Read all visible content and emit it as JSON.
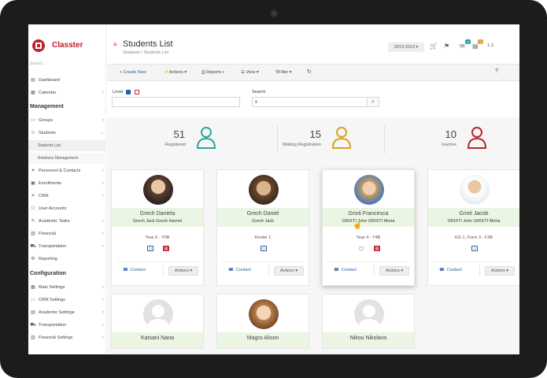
{
  "app": {
    "name": "Classter",
    "search_placeholder": "Search...",
    "brand_color": "#c0222b",
    "link_color": "#2a5d9f"
  },
  "sidebar": {
    "items": [
      {
        "label": "Dashboard",
        "icon": "dashboard-icon"
      },
      {
        "label": "Calendar",
        "icon": "calendar-icon"
      }
    ],
    "management_title": "Management",
    "management": [
      {
        "label": "Groups",
        "icon": "groups-icon"
      },
      {
        "label": "Students",
        "icon": "student-icon"
      },
      {
        "label": "Personnel & Contacts",
        "icon": "personnel-icon"
      },
      {
        "label": "Enrollments",
        "icon": "enrollment-icon"
      },
      {
        "label": "CRM",
        "icon": "crm-icon"
      },
      {
        "label": "User Accounts",
        "icon": "user-accounts-icon"
      },
      {
        "label": "Academic Tasks",
        "icon": "academic-tasks-icon"
      },
      {
        "label": "Financial",
        "icon": "financial-icon"
      },
      {
        "label": "Transportation",
        "icon": "transportation-icon"
      },
      {
        "label": "Reporting",
        "icon": "reporting-icon"
      }
    ],
    "students_sub": [
      "Students List",
      "Relatives Management"
    ],
    "configuration_title": "Configuration",
    "configuration": [
      {
        "label": "Main Settings",
        "icon": "main-settings-icon"
      },
      {
        "label": "CRM Settings",
        "icon": "crm-settings-icon"
      },
      {
        "label": "Academic Settings",
        "icon": "academic-settings-icon"
      },
      {
        "label": "Transportation",
        "icon": "transportation-icon"
      },
      {
        "label": "Financial Settings",
        "icon": "financial-settings-icon"
      }
    ]
  },
  "header": {
    "title": "Students List",
    "breadcrumb": [
      "Students",
      "/",
      "Students List"
    ],
    "year": "2013-2013",
    "messages_badge": "4",
    "notifications_badge": "2",
    "user_menu": "1.1"
  },
  "toolbar": {
    "create": "+ Create New",
    "actions": "Actions",
    "reports": "Reports",
    "view": "View",
    "filter": "Filter",
    "help": "?"
  },
  "filters": {
    "level_label": "Level",
    "search_label": "Search",
    "search_value": "x"
  },
  "stats": [
    {
      "value": "51",
      "label": "Registered",
      "color": "#2aa89a"
    },
    {
      "value": "15",
      "label": "Waiting Registration",
      "color": "#d6a22a"
    },
    {
      "value": "10",
      "label": "Inactive",
      "color": "#b8282f"
    }
  ],
  "cards": [
    {
      "name": "Grech Daniela",
      "parents": "Grech Jack Grech Harriet",
      "class": "Year 6 - Y6B",
      "contact": "Contact",
      "actions": "Actions"
    },
    {
      "name": "Grech Daniel",
      "parents": "Grech Jack",
      "class": "Kinder 1",
      "contact": "Contact",
      "actions": "Actions"
    },
    {
      "name": "Grixti Francesca",
      "parents": "GRIXTI John GRIXTI Moira",
      "class": "Year 4 - Y4B",
      "contact": "Contact",
      "actions": "Actions"
    },
    {
      "name": "Grixti Jacob",
      "parents": "GRIXTI John GRIXTI Moira",
      "class": "KG 1, Form 3 - F3B",
      "contact": "Contact",
      "actions": "Actions"
    },
    {
      "name": "Katsani Nana"
    },
    {
      "name": "Magro Alison"
    },
    {
      "name": "Nikou Nikolaos"
    }
  ]
}
